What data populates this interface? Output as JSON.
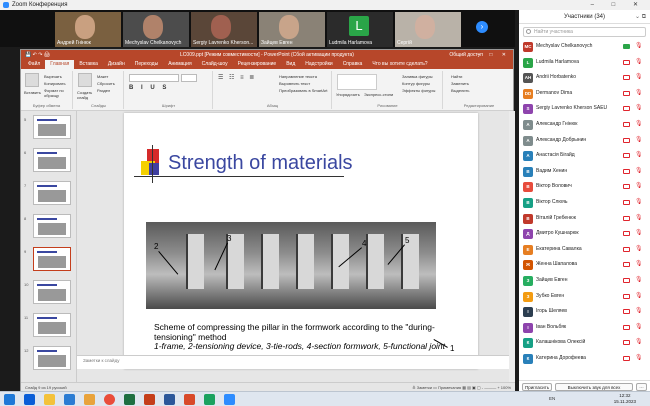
{
  "zoom": {
    "title": "Zoom Конференция",
    "window_controls": "– □ ✕"
  },
  "gallery": [
    {
      "name": "Андрей Гнінюк",
      "type": "video",
      "skin": "#c9a080",
      "bg": "#7a6040"
    },
    {
      "name": "Mechyslav Chelkanovych",
      "type": "video",
      "skin": "#b0826a",
      "bg": "#4c4c4c"
    },
    {
      "name": "Sergiy Lavrenko Kherson...",
      "type": "video",
      "skin": "#a06050",
      "bg": "#5a4638"
    },
    {
      "name": "Зайцев Евген",
      "type": "video",
      "skin": "#c8a48a",
      "bg": "#8a8276"
    },
    {
      "name": "Ludmila Harlamova",
      "type": "initial",
      "letter": "L"
    },
    {
      "name": "Сергій",
      "type": "video",
      "skin": "#d0b0a0",
      "bg": "#b9b2a8"
    }
  ],
  "powerpoint": {
    "title": "LC009.ppt [Режим совместимости] - PowerPoint (Сбой активации продукта)",
    "qat": "💾 ↶ ↷ 🖨",
    "account": "Общий доступ",
    "window_controls": "– □ ✕",
    "tabs": [
      "Файл",
      "Главная",
      "Вставка",
      "Дизайн",
      "Переходы",
      "Анимация",
      "Слайд-шоу",
      "Рецензирование",
      "Вид",
      "Надстройки",
      "Справка",
      "Что вы хотите сделать?"
    ],
    "ribbon": {
      "clipboard": {
        "paste": "Вставить",
        "cut": "Вырезать",
        "copy": "Копировать",
        "format": "Формат по образцу",
        "label": "Буфер обмена"
      },
      "slides": {
        "new": "Создать слайд",
        "layout": "Макет",
        "reset": "Сбросить",
        "section": "Раздел",
        "label": "Слайды"
      },
      "font": {
        "label": "Шрифт"
      },
      "paragraph": {
        "l1": "Направление текста",
        "l2": "Выровнять текст",
        "l3": "Преобразовать в SmartArt",
        "label": "Абзац"
      },
      "drawing": {
        "arrange": "Упорядочить",
        "styles": "Экспресс-стили",
        "l1": "Заливка фигуры",
        "l2": "Контур фигуры",
        "l3": "Эффекты фигуры",
        "label": "Рисование"
      },
      "editing": {
        "find": "Найти",
        "replace": "Заменить",
        "select": "Выделить",
        "label": "Редактирование"
      }
    },
    "thumbnails": [
      "5",
      "6",
      "7",
      "8",
      "9",
      "10",
      "11",
      "12"
    ],
    "notes_placeholder": "Заметки к слайду",
    "status_left": "Слайд 9 из 19    русский",
    "status_right": "≜ Заметки   ▭ Примечания   ▦ ▤ ▣ ▢   - ——— +   100%"
  },
  "slide": {
    "title": "Strength of materials",
    "labels": [
      "1",
      "2",
      "3",
      "4",
      "5"
    ],
    "caption": "Scheme of compressing the pillar in the formwork according to the \"during-tensioning\" method",
    "legend": "1-frame, 2-tensioning device, 3-tie-rods, 4-section formwork, 5-functional joint"
  },
  "participants": {
    "header": "Участники (34)",
    "search_placeholder": "Найти участника",
    "list": [
      {
        "initials": "MC",
        "name": "Mechyslav Chelkanovych",
        "color": "#c0392b",
        "video": true
      },
      {
        "initials": "L",
        "name": "Ludmila Harlamova",
        "color": "#2aa548",
        "video": false
      },
      {
        "initials": "AH",
        "name": "Andrii Horbatenko",
        "color": "#555555",
        "video": false
      },
      {
        "initials": "DD",
        "name": "Dermanov Dima",
        "color": "#e67e22",
        "video": false
      },
      {
        "initials": "S",
        "name": "Sergiy Lavrenko Kherson SAEU",
        "color": "#8e44ad",
        "video": false
      },
      {
        "initials": "А",
        "name": "Александр Гнінюк",
        "color": "#7f8c8d",
        "video": false
      },
      {
        "initials": "А",
        "name": "Александр Добрынин",
        "color": "#7f8c8d",
        "video": false
      },
      {
        "initials": "А",
        "name": "Анастасія Бігайд",
        "color": "#2980b9",
        "video": false
      },
      {
        "initials": "В",
        "name": "Вадим Хенин",
        "color": "#2980b9",
        "video": false
      },
      {
        "initials": "В",
        "name": "Віктор Волович",
        "color": "#e74c3c",
        "video": false
      },
      {
        "initials": "В",
        "name": "Віктор Слюяь",
        "color": "#16a085",
        "video": false
      },
      {
        "initials": "В",
        "name": "Віталій Гребенюк",
        "color": "#c0392b",
        "video": false
      },
      {
        "initials": "Д",
        "name": "Дмитро Кушнарюк",
        "color": "#8e44ad",
        "video": false
      },
      {
        "initials": "Е",
        "name": "Екатерина Савалка",
        "color": "#e67e22",
        "video": false
      },
      {
        "initials": "Ж",
        "name": "Женна Шапалова",
        "color": "#d35400",
        "video": false
      },
      {
        "initials": "З",
        "name": "Зайцев Евген",
        "color": "#27ae60",
        "video": false
      },
      {
        "initials": "З",
        "name": "Зубко Евген",
        "color": "#f39c12",
        "video": false
      },
      {
        "initials": "І",
        "name": "Ігорь Шеляев",
        "color": "#2c3e50",
        "video": false
      },
      {
        "initials": "І",
        "name": "Іван Вольбяк",
        "color": "#8e44ad",
        "video": false
      },
      {
        "initials": "К",
        "name": "Калашнікова Олексій",
        "color": "#16a085",
        "video": false
      },
      {
        "initials": "К",
        "name": "Катерина Дорофеева",
        "color": "#2980b9",
        "video": false
      }
    ],
    "invite": "Пригласить",
    "mute_all": "Выключить звук для всех",
    "more": "···"
  },
  "taskbar": {
    "lang": "EN",
    "time": "12:32",
    "date": "15.11.2023"
  }
}
